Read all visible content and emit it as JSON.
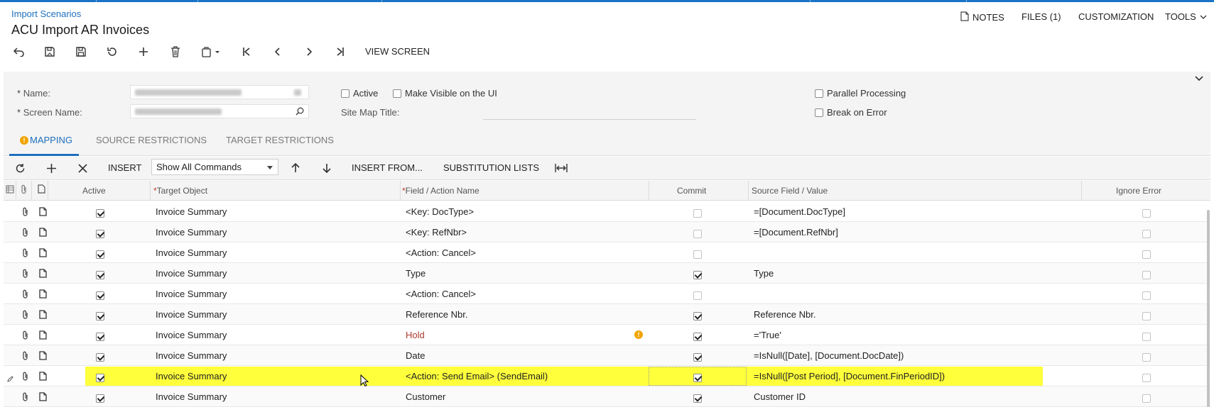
{
  "breadcrumb": "Import Scenarios",
  "title": "ACU Import AR Invoices",
  "top_links": {
    "notes": "NOTES",
    "files": "FILES (1)",
    "customization": "CUSTOMIZATION",
    "tools": "TOOLS"
  },
  "toolbar": {
    "view_screen": "VIEW SCREEN"
  },
  "form": {
    "name_label": "Name:",
    "screen_name_label": "Screen Name:",
    "required_mark": "*",
    "active_label": "Active",
    "active_checked": false,
    "visible_label": "Make Visible on the UI",
    "visible_checked": false,
    "site_map_label": "Site Map Title:",
    "parallel_label": "Parallel Processing",
    "parallel_checked": false,
    "break_label": "Break on Error",
    "break_checked": false
  },
  "tabs": [
    {
      "label": "MAPPING",
      "active": true
    },
    {
      "label": "SOURCE RESTRICTIONS",
      "active": false
    },
    {
      "label": "TARGET RESTRICTIONS",
      "active": false
    }
  ],
  "grid_toolbar": {
    "insert": "INSERT",
    "filter_value": "Show All Commands",
    "insert_from": "INSERT FROM...",
    "substitution_lists": "SUBSTITUTION LISTS"
  },
  "columns": {
    "active": "Active",
    "target_object": "Target Object",
    "field_action": "Field / Action Name",
    "commit": "Commit",
    "source_field": "Source Field / Value",
    "ignore_error": "Ignore Error"
  },
  "rows": [
    {
      "active": true,
      "target": "Invoice Summary",
      "field": "<Key: DocType>",
      "commit": false,
      "source": "=[Document.DocType]",
      "ignore": false
    },
    {
      "active": true,
      "target": "Invoice Summary",
      "field": "<Key: RefNbr>",
      "commit": false,
      "source": "=[Document.RefNbr]",
      "ignore": false
    },
    {
      "active": true,
      "target": "Invoice Summary",
      "field": "<Action: Cancel>",
      "commit": false,
      "source": "",
      "ignore": false
    },
    {
      "active": true,
      "target": "Invoice Summary",
      "field": "Type",
      "commit": true,
      "source": "Type",
      "ignore": false
    },
    {
      "active": true,
      "target": "Invoice Summary",
      "field": "<Action: Cancel>",
      "commit": false,
      "source": "",
      "ignore": false
    },
    {
      "active": true,
      "target": "Invoice Summary",
      "field": "Reference Nbr.",
      "commit": true,
      "source": "Reference Nbr.",
      "ignore": false
    },
    {
      "active": true,
      "target": "Invoice Summary",
      "field": "Hold",
      "commit": true,
      "source": "='True'",
      "ignore": false,
      "warning": true
    },
    {
      "active": true,
      "target": "Invoice Summary",
      "field": "Date",
      "commit": true,
      "source": "=IsNull([Date], [Document.DocDate])",
      "ignore": false
    },
    {
      "active": true,
      "target": "Invoice Summary",
      "field": "<Action: Send Email> (SendEmail)",
      "commit": true,
      "source": "=IsNull([Post Period], [Document.FinPeriodID])",
      "ignore": false,
      "highlighted": true
    },
    {
      "active": true,
      "target": "Invoice Summary",
      "field": "Customer",
      "commit": true,
      "source": "Customer ID",
      "ignore": false
    }
  ],
  "colors": {
    "accent": "#1e6fbd",
    "highlight": "#ffff3c",
    "warning": "#f0a500",
    "hold_text": "#b03a2e"
  }
}
